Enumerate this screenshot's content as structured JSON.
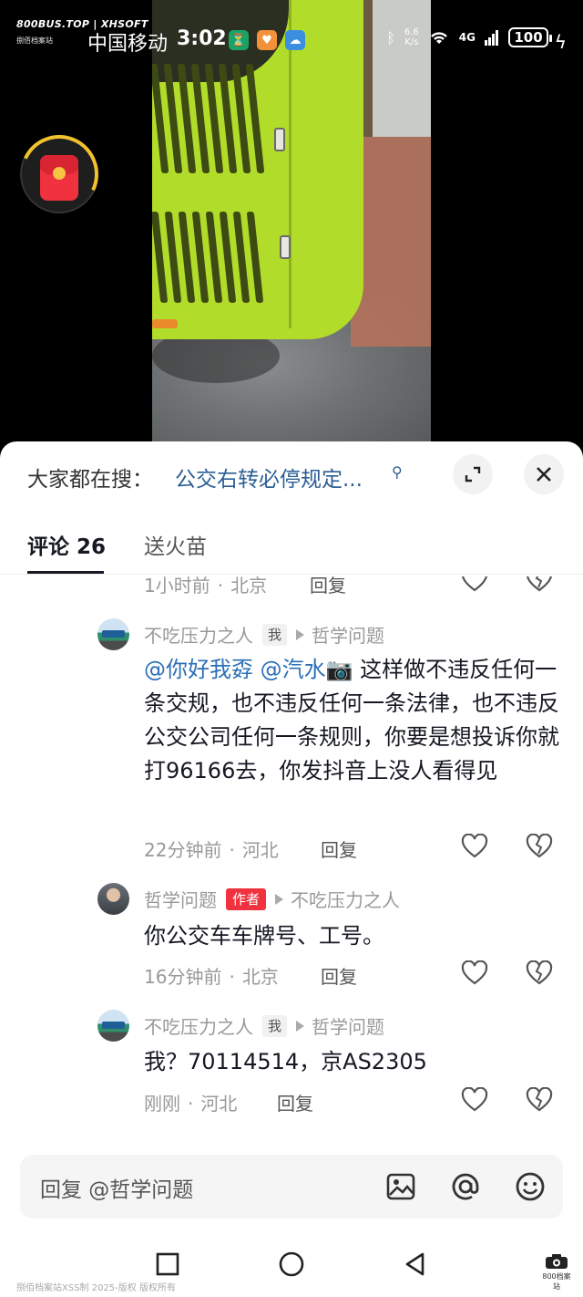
{
  "status_bar": {
    "watermark_top": "800BUS.TOP | XHSOFT",
    "watermark_sub": "捌佰档案站",
    "carrier": "中国移动",
    "time": "3:02",
    "net_speed_value": "6.6",
    "net_speed_unit": "K/s",
    "signal_label": "4G",
    "battery": "100"
  },
  "sheet": {
    "search_prefix": "大家都在搜：",
    "search_query": "公交右转必停规定...",
    "tabs": [
      {
        "label": "评论 26",
        "active": true
      },
      {
        "label": "送火苗",
        "active": false
      }
    ]
  },
  "comments": {
    "partial": {
      "time": "1小时前",
      "location": "北京",
      "reply_label": "回复"
    },
    "items": [
      {
        "author": "不吃压力之人",
        "tag": "我",
        "reply_to": "哲学问题",
        "mentions": [
          "@你好我孬",
          "@汽水📷"
        ],
        "text": "这样做不违反任何一条交规，也不违反任何一条法律，也不违反公交公司任何一条规则，你要是想投诉你就打96166去，你发抖音上没人看得见",
        "time": "22分钟前",
        "location": "河北",
        "reply_label": "回复",
        "avatar": "bus-avatar"
      },
      {
        "author": "哲学问题",
        "tag": "作者",
        "reply_to": "不吃压力之人",
        "text": "你公交车车牌号、工号。",
        "time": "16分钟前",
        "location": "北京",
        "reply_label": "回复",
        "avatar": "man-avatar"
      },
      {
        "author": "不吃压力之人",
        "tag": "我",
        "reply_to": "哲学问题",
        "text": "我？70114514，京AS2305",
        "time": "刚刚",
        "location": "河北",
        "reply_label": "回复",
        "avatar": "bus-avatar"
      }
    ]
  },
  "reply_bar": {
    "placeholder": "回复 @哲学问题",
    "icons": [
      "image-icon",
      "at-icon",
      "emoji-icon"
    ]
  },
  "nav_bar": {
    "icons": [
      "recent-apps-icon",
      "home-icon",
      "back-icon"
    ],
    "watermark_bottom": "捌佰档案站XSS制 2025-版权 版权所有",
    "logo_text": "800档案站"
  },
  "colors": {
    "accent_link": "#2b6fb7",
    "search_link": "#2b5e93",
    "author_tag": "#f0323e",
    "bus_green": "#b2dc2a"
  }
}
